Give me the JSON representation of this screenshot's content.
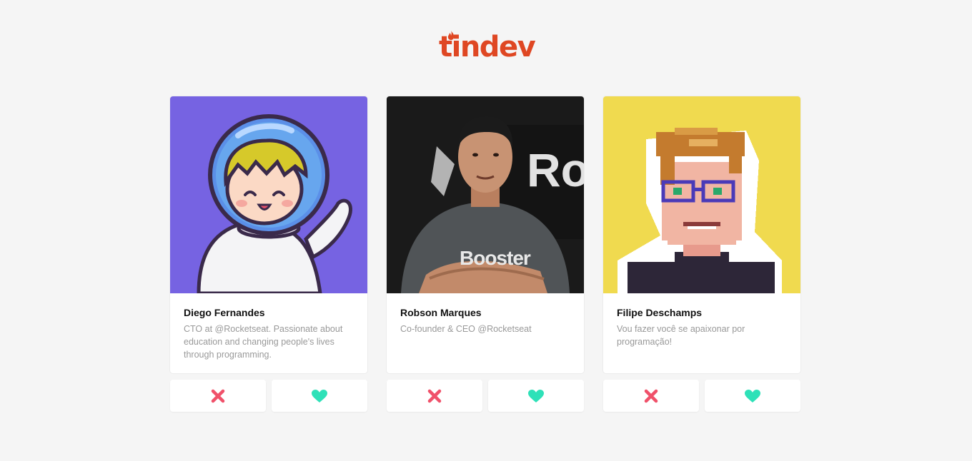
{
  "app": {
    "logo_text": "tindev",
    "logo_color": "#df4723"
  },
  "cards": [
    {
      "name": "Diego Fernandes",
      "bio": "CTO at @Rocketseat. Passionate about education and changing people's lives through programming.",
      "avatar_icon": "astronaut-avatar",
      "avatar_bg": "#7663e2",
      "dislike_icon": "x-icon",
      "like_icon": "heart-icon"
    },
    {
      "name": "Robson Marques",
      "bio": "Co-founder & CEO @Rocketseat",
      "avatar_icon": "person-photo-avatar",
      "avatar_bg": "#1a1a1a",
      "avatar_overlay_text": "Ro",
      "shirt_text": "Booster",
      "dislike_icon": "x-icon",
      "like_icon": "heart-icon"
    },
    {
      "name": "Filipe Deschamps",
      "bio": "Vou fazer você se apaixonar por programação!",
      "avatar_icon": "pixel-art-avatar",
      "avatar_bg": "#f0da4f",
      "dislike_icon": "x-icon",
      "like_icon": "heart-icon"
    }
  ],
  "colors": {
    "dislike": "#f0516a",
    "like": "#2ee1b8",
    "page_background": "#f5f5f5"
  }
}
